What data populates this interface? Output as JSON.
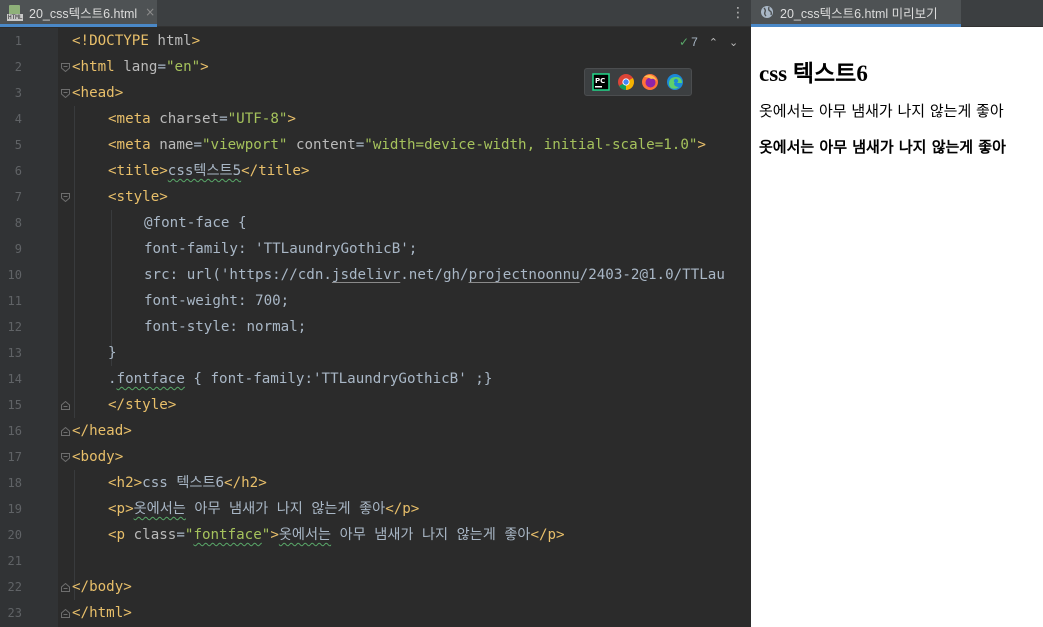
{
  "editor": {
    "tab": {
      "label": "20_css텍스트6.html",
      "close": "×",
      "file_icon_text": "HTML"
    },
    "menu_glyph": "⋮",
    "inspection": {
      "count": "7",
      "check_glyph": "✓",
      "up": "⌃",
      "down": "⌄"
    },
    "browser_bar": [
      "pycharm-icon",
      "chrome-icon",
      "firefox-icon",
      "edge-icon"
    ],
    "line_numbers": [
      "1",
      "2",
      "3",
      "4",
      "5",
      "6",
      "7",
      "8",
      "9",
      "10",
      "11",
      "12",
      "13",
      "14",
      "15",
      "16",
      "17",
      "18",
      "19",
      "20",
      "21",
      "22",
      "23"
    ],
    "lines": {
      "l1": {
        "open": "<!DOCTYPE",
        "rest": " html",
        "close": ">"
      },
      "l2": {
        "open": "<html",
        "attr": " lang",
        "eq": "=",
        "val": "\"en\"",
        "close": ">"
      },
      "l3": {
        "tag": "<head>"
      },
      "l4": {
        "open": "<meta",
        "attr": " charset",
        "eq": "=",
        "val": "\"UTF-8\"",
        "close": ">"
      },
      "l5": {
        "open": "<meta",
        "attr1": " name",
        "eq1": "=",
        "val1": "\"viewport\"",
        "attr2": " content",
        "eq2": "=",
        "val2": "\"width=device-width, initial-scale=1.0\"",
        "close": ">"
      },
      "l6": {
        "open": "<title>",
        "text": "css텍스트5",
        "close": "</title>"
      },
      "l7": {
        "tag": "<style>"
      },
      "l8": {
        "text": "@font-face {"
      },
      "l9": {
        "text": "font-family: 'TTLaundryGothicB';"
      },
      "l10": {
        "pre": "src: url('",
        "url1": "https://cdn.",
        "url2": "jsdelivr",
        "url3": ".net/gh/",
        "url4": "projectnoonnu",
        "url5": "/2403-2@1.0/TTLau"
      },
      "l11": {
        "text": "font-weight: 700;"
      },
      "l12": {
        "text": "font-style: normal;"
      },
      "l13": {
        "text": "}"
      },
      "l14": {
        "dot": ".",
        "cls": "fontface",
        "rest": " { font-family:'TTLaundryGothicB' ;}"
      },
      "l15": {
        "tag": "</style>"
      },
      "l16": {
        "tag": "</head>"
      },
      "l17": {
        "tag": "<body>"
      },
      "l18": {
        "open": "<h2>",
        "text": "css 텍스트6",
        "close": "</h2>"
      },
      "l19": {
        "open": "<p>",
        "text1": "옷에서는",
        "text2": " 아무 냄새가 나지 않는게 좋아",
        "close": "</p>"
      },
      "l20": {
        "open": "<p",
        "attr": " class",
        "eq": "=",
        "val_q1": "\"",
        "val": "fontface",
        "val_q2": "\"",
        "gt": ">",
        "text1": "옷에서는",
        "text2": " 아무 냄새가 나지 않는게 좋아",
        "close": "</p>"
      },
      "l21": {
        "text": ""
      },
      "l22": {
        "tag": "</body>"
      },
      "l23": {
        "tag": "</html>"
      }
    }
  },
  "preview": {
    "tab": {
      "label": "20_css텍스트6.html 미리보기",
      "icon": "globe-icon"
    },
    "h2": "css 텍스트6",
    "p1": "옷에서는 아무 냄새가 나지 않는게 좋아",
    "p2": "옷에서는 아무 냄새가 나지 않는게 좋아"
  },
  "colors": {
    "editor_bg": "#2b2b2b",
    "gutter_bg": "#313335",
    "tag": "#e8bf6a",
    "attr_name": "#bababa",
    "attr_value": "#a5c25c",
    "text": "#a9b7c6",
    "accent": "#4a88c7"
  }
}
